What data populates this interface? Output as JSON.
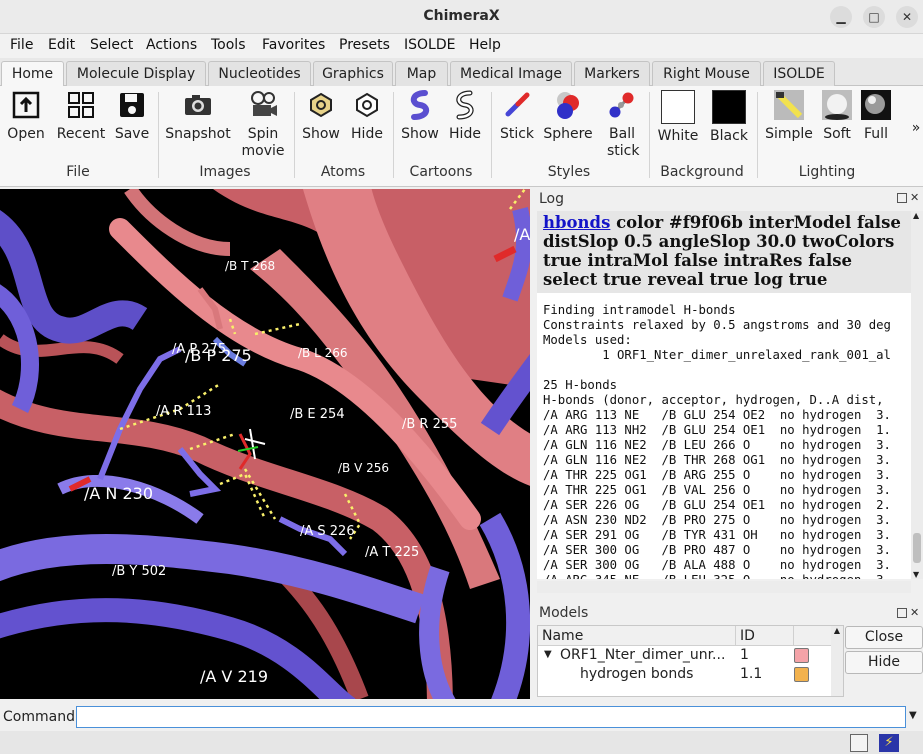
{
  "window": {
    "title": "ChimeraX"
  },
  "menu": [
    "File",
    "Edit",
    "Select",
    "Actions",
    "Tools",
    "Favorites",
    "Presets",
    "ISOLDE",
    "Help"
  ],
  "tabs": [
    {
      "label": "Home",
      "active": true
    },
    {
      "label": "Molecule Display"
    },
    {
      "label": "Nucleotides"
    },
    {
      "label": "Graphics"
    },
    {
      "label": "Map"
    },
    {
      "label": "Medical Image"
    },
    {
      "label": "Markers"
    },
    {
      "label": "Right Mouse"
    },
    {
      "label": "ISOLDE"
    }
  ],
  "ribbon": {
    "buttons": [
      "Open",
      "Recent",
      "Save",
      "Snapshot",
      "Spin movie",
      "Show",
      "Hide",
      "Show",
      "Hide",
      "Stick",
      "Sphere",
      "Ball stick",
      "White",
      "Black",
      "Simple",
      "Soft",
      "Full"
    ],
    "groups": [
      "File",
      "Images",
      "Atoms",
      "Cartoons",
      "Styles",
      "Background",
      "Lighting"
    ],
    "more": "»"
  },
  "viewport": {
    "labels": [
      "/B T 268",
      "/A P 275",
      "/B P 275",
      "/B L 266",
      "/A R 113",
      "/B E 254",
      "/B R 255",
      "/B V 256",
      "/A N 230",
      "/A S 226",
      "/A T 225",
      "/B Y 502",
      "/A V 219",
      "/A"
    ]
  },
  "log": {
    "title": "Log",
    "command_link": "hbonds",
    "command_rest": " color #f9f06b interModel false distSlop 0.5 angleSlop 30.0 twoColors true intraMol false intraRes false select true reveal true log true",
    "lines": [
      "Finding intramodel H-bonds",
      "Constraints relaxed by 0.5 angstroms and 30 deg",
      "Models used:",
      "        1 ORF1_Nter_dimer_unrelaxed_rank_001_al",
      "",
      "25 H-bonds",
      "H-bonds (donor, acceptor, hydrogen, D..A dist,",
      "/A ARG 113 NE   /B GLU 254 OE2  no hydrogen  3.",
      "/A ARG 113 NH2  /B GLU 254 OE1  no hydrogen  1.",
      "/A GLN 116 NE2  /B LEU 266 O    no hydrogen  3.",
      "/A GLN 116 NE2  /B THR 268 OG1  no hydrogen  3.",
      "/A THR 225 OG1  /B ARG 255 O    no hydrogen  3.",
      "/A THR 225 OG1  /B VAL 256 O    no hydrogen  3.",
      "/A SER 226 OG   /B GLU 254 OE1  no hydrogen  2.",
      "/A ASN 230 ND2  /B PRO 275 O    no hydrogen  3.",
      "/A SER 291 OG   /B TYR 431 OH   no hydrogen  3.",
      "/A SER 300 OG   /B PRO 487 O    no hydrogen  3.",
      "/A SER 300 OG   /B ALA 488 O    no hydrogen  3.",
      "/A ARG 345 NE   /B LEU 325 O    no hydrogen  3."
    ]
  },
  "models": {
    "title": "Models",
    "columns": [
      "Name",
      "ID"
    ],
    "rows": [
      {
        "name": "ORF1_Nter_dimer_unr...",
        "id": "1",
        "color": "#f4a3a8",
        "toggle": "▼"
      },
      {
        "name": "hydrogen bonds",
        "id": "1.1",
        "color": "#f2b24e"
      }
    ],
    "buttons": [
      "Close",
      "Hide"
    ]
  },
  "command": {
    "label": "Command:",
    "value": ""
  },
  "colors": {
    "chainA": "#6f5fd9",
    "chainB": "#d9787c",
    "hbond": "#f9f06b",
    "accent": "#4a90d9"
  }
}
